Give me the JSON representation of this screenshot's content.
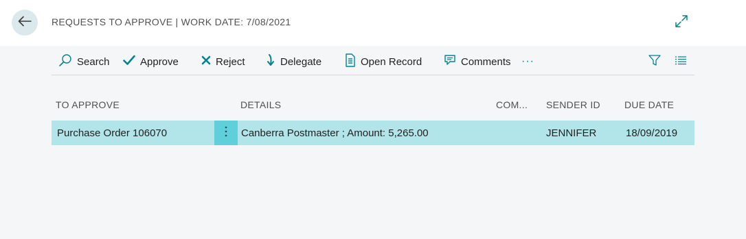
{
  "header": {
    "title": "REQUESTS TO APPROVE | WORK DATE: 7/08/2021"
  },
  "toolbar": {
    "search_label": "Search",
    "approve_label": "Approve",
    "reject_label": "Reject",
    "delegate_label": "Delegate",
    "open_record_label": "Open Record",
    "comments_label": "Comments",
    "more_label": "···"
  },
  "columns": {
    "to_approve": "TO APPROVE",
    "details": "DETAILS",
    "comment": "COM...",
    "sender_id": "SENDER ID",
    "due_date": "DUE DATE"
  },
  "rows": [
    {
      "to_approve": "Purchase Order 106070",
      "details": "Canberra Postmaster ; Amount: 5,265.00",
      "comment": "",
      "sender_id": "JENNIFER",
      "due_date": "18/09/2019"
    }
  ],
  "icons": {
    "back": "arrow-left-icon",
    "expand": "expand-icon",
    "search": "search-icon",
    "approve": "checkmark-icon",
    "reject": "x-icon",
    "delegate": "arrow-down-icon",
    "open_record": "document-icon",
    "comments": "comment-icon",
    "filter": "filter-icon",
    "list": "list-icon",
    "row_menu": "vertical-ellipsis-icon"
  },
  "colors": {
    "accent": "#00838f",
    "selected_row": "#b2e5e9",
    "row_menu_bg": "#5fd0d9",
    "back_button_bg": "#dbe9ec"
  }
}
